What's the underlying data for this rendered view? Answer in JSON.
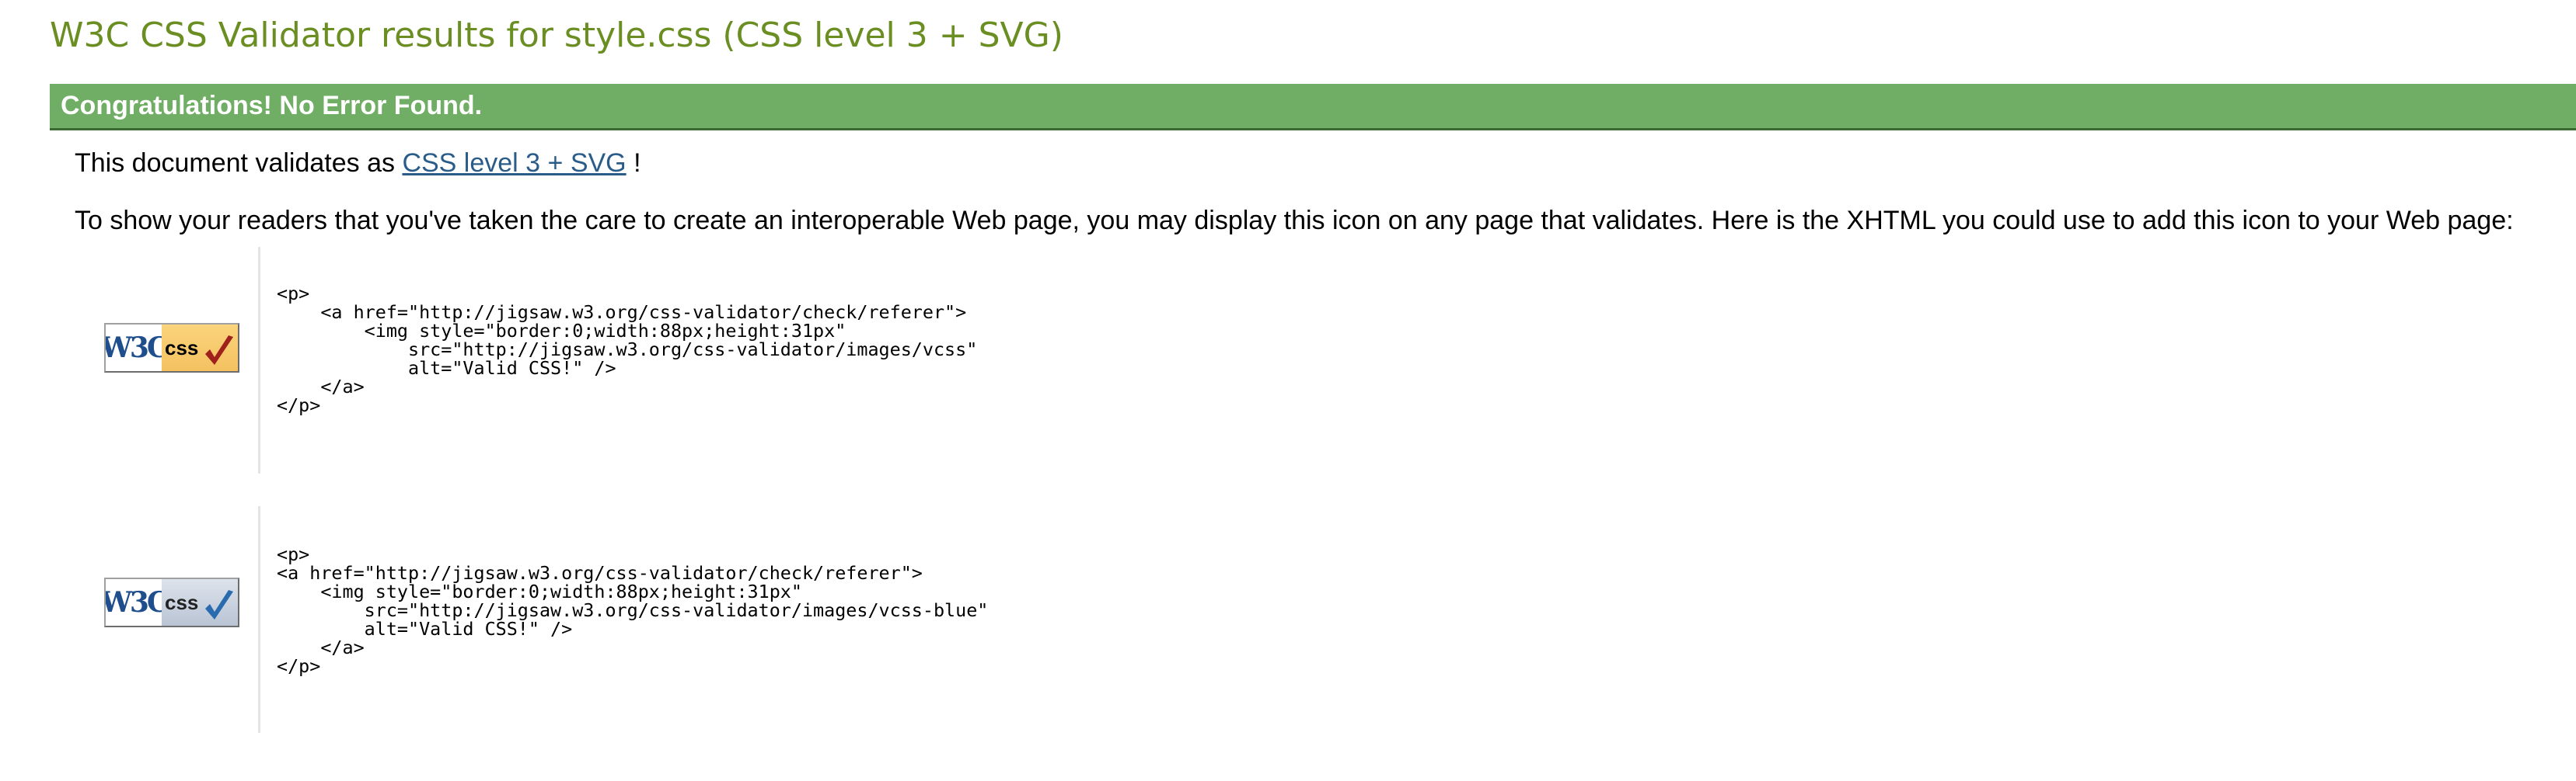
{
  "page": {
    "title": "W3C CSS Validator results for style.css (CSS level 3 + SVG)"
  },
  "banner": {
    "text": "Congratulations! No Error Found."
  },
  "validation": {
    "prefix": "This document validates as",
    "link_label": "CSS level 3 + SVG",
    "suffix": "!"
  },
  "instructions": {
    "text": "To show your readers that you've taken the care to create an interoperable Web page, you may display this icon on any page that validates. Here is the XHTML you could use to add this icon to your Web page:"
  },
  "badges": [
    {
      "w3c_label": "W3C",
      "css_label": "css",
      "variant": "gold",
      "check_color": "#a0201c",
      "code": "<p>\n    <a href=\"http://jigsaw.w3.org/css-validator/check/referer\">\n        <img style=\"border:0;width:88px;height:31px\"\n            src=\"http://jigsaw.w3.org/css-validator/images/vcss\"\n            alt=\"Valid CSS!\" />\n    </a>\n</p>"
    },
    {
      "w3c_label": "W3C",
      "css_label": "css",
      "variant": "blue",
      "check_color": "#2a6bb0",
      "code": "<p>\n<a href=\"http://jigsaw.w3.org/css-validator/check/referer\">\n    <img style=\"border:0;width:88px;height:31px\"\n        src=\"http://jigsaw.w3.org/css-validator/images/vcss-blue\"\n        alt=\"Valid CSS!\" />\n    </a>\n</p>"
    }
  ],
  "colors": {
    "title": "#6b8e23",
    "banner_bg": "#6fae64",
    "link": "#2a5c8a"
  }
}
